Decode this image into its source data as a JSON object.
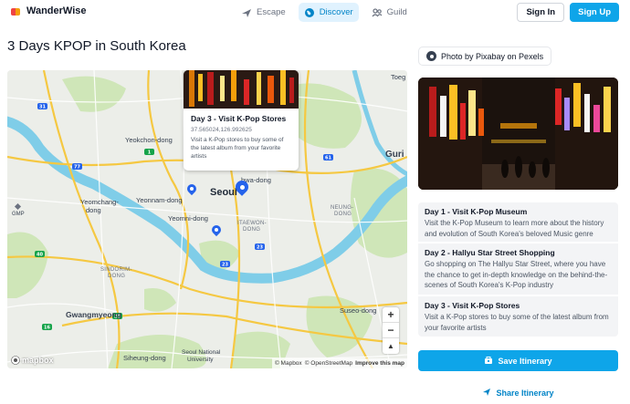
{
  "app": {
    "name": "WanderWise"
  },
  "nav": {
    "tabs": [
      {
        "label": "Escape",
        "icon": "plane-icon"
      },
      {
        "label": "Discover",
        "icon": "globe-icon",
        "active": true
      },
      {
        "label": "Guild",
        "icon": "users-icon"
      }
    ],
    "sign_in": "Sign In",
    "sign_up": "Sign Up"
  },
  "page": {
    "title": "3 Days KPOP in South Korea"
  },
  "map": {
    "labels": {
      "yeokchon": "Yeokchon-dong",
      "guri": "Guri",
      "toeg": "Toeg",
      "yeomchang": "Yeomchang-",
      "dong": "dong",
      "yeonnam": "Yeonnam-dong",
      "seoul": "Seoul",
      "hwa": "hwa-dong",
      "yeomni": "Yeomni-dong",
      "itaewon1": "ITAEWON-",
      "itaewon2": "DONG",
      "neung1": "NEUNG-",
      "neung2": "DONG",
      "sindorim1": "SINDORIM-",
      "sindorim2": "DONG",
      "gwangmyeong": "Gwangmyeong",
      "suseo": "Suseo-dong",
      "siheung": "Siheung-dong",
      "snu1": "Seoul National",
      "snu2": "University",
      "gmp": "GMP"
    },
    "popup": {
      "title": "Day 3 - Visit K-Pop Stores",
      "coords": "37.565024,126.992625",
      "description": "Visit a K-Pop stores to buy some of the latest album from your favorite artists"
    },
    "zoom_in": "+",
    "zoom_out": "−",
    "compass": "▲",
    "logo": "mapbox",
    "attribution": {
      "mapbox": "© Mapbox",
      "osm": "© OpenStreetMap",
      "improve": "Improve this map"
    }
  },
  "sidebar": {
    "photo_credit": "Photo by Pixabay on Pexels",
    "days": [
      {
        "title": "Day 1 - Visit K-Pop Museum",
        "description": "Visit the K-Pop Museum to learn more about the history and evolution of South Korea's beloved Music genre"
      },
      {
        "title": "Day 2 - Hallyu Star Street Shopping",
        "description": "Go shopping on The Hallyu Star Street, where you have the chance to get in-depth knowledge on the behind-the-scenes of South Korea's K-Pop industry"
      },
      {
        "title": "Day 3 - Visit K-Pop Stores",
        "description": "Visit a K-Pop stores to buy some of the latest album from your favorite artists"
      }
    ],
    "save_label": "Save Itinerary",
    "share_label": "Share Itinerary"
  },
  "colors": {
    "accent": "#0ea5e9",
    "river": "#7fcde8",
    "park": "#cfe6b8",
    "road_major": "#f5c842",
    "pin": "#2563eb"
  }
}
